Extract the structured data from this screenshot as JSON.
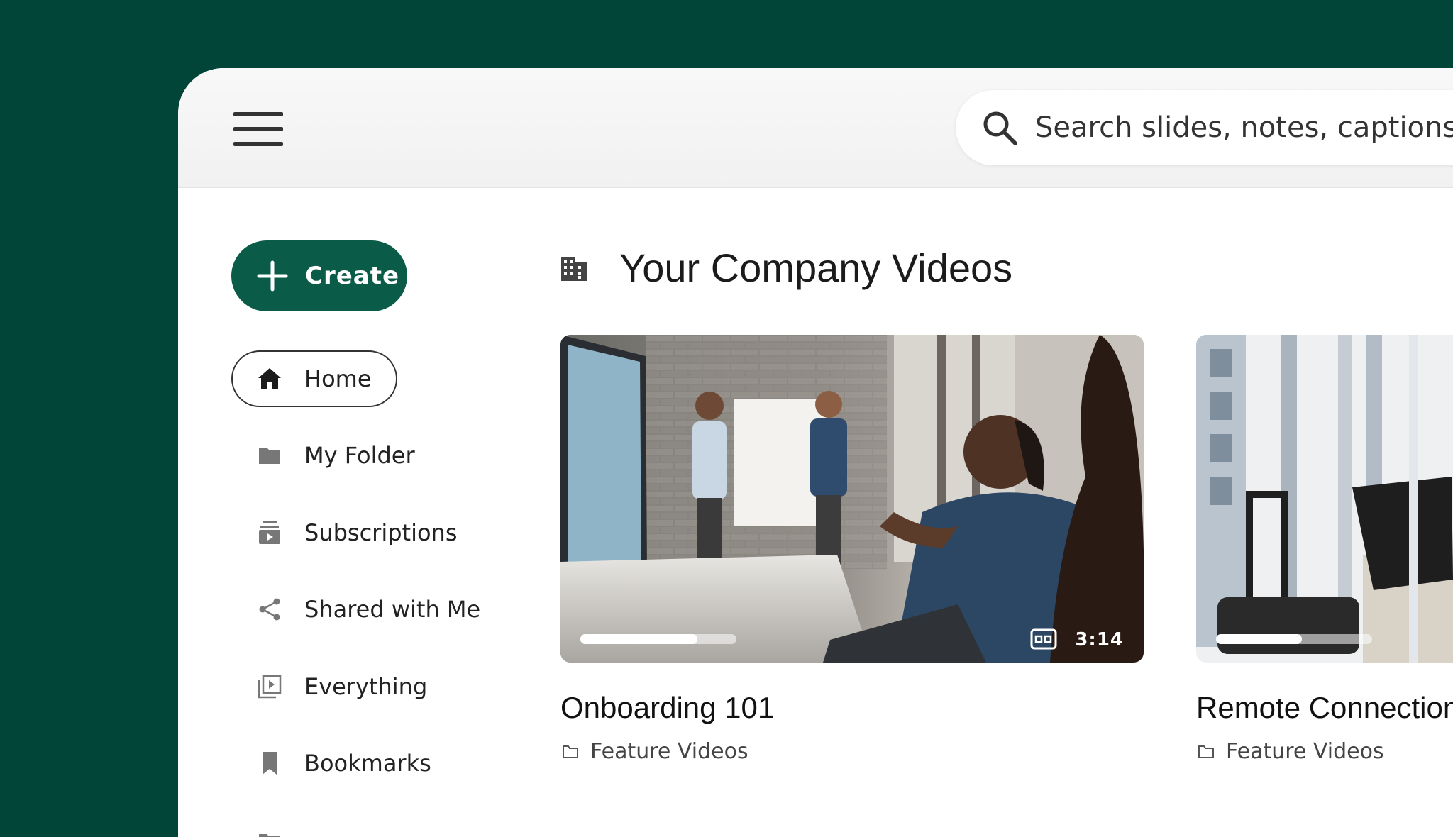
{
  "topbar": {
    "search_placeholder": "Search slides, notes, captions and more",
    "menu_icon": "hamburger-menu-icon",
    "search_icon": "search-icon"
  },
  "sidebar": {
    "create_label": "Create",
    "items": [
      {
        "label": "Home",
        "icon": "home-icon",
        "active": true
      },
      {
        "label": "My Folder",
        "icon": "folder-icon",
        "active": false
      },
      {
        "label": "Subscriptions",
        "icon": "subscriptions-icon",
        "active": false
      },
      {
        "label": "Shared with Me",
        "icon": "share-icon",
        "active": false
      },
      {
        "label": "Everything",
        "icon": "video-library-icon",
        "active": false
      },
      {
        "label": "Bookmarks",
        "icon": "bookmark-icon",
        "active": false
      },
      {
        "label": "",
        "icon": "partial-item-icon",
        "active": false
      }
    ]
  },
  "main": {
    "section_title": "Your Company Videos",
    "section_icon": "company-building-icon",
    "videos": [
      {
        "title": "Onboarding 101",
        "folder": "Feature Videos",
        "duration": "3:14",
        "has_captions": true,
        "progress": 0.75
      },
      {
        "title": "Remote Connections",
        "folder": "Feature Videos",
        "duration": "",
        "has_captions": false,
        "progress": 0.55
      }
    ]
  },
  "colors": {
    "background": "#004538",
    "accent": "#0a5c48",
    "text": "#222222"
  }
}
